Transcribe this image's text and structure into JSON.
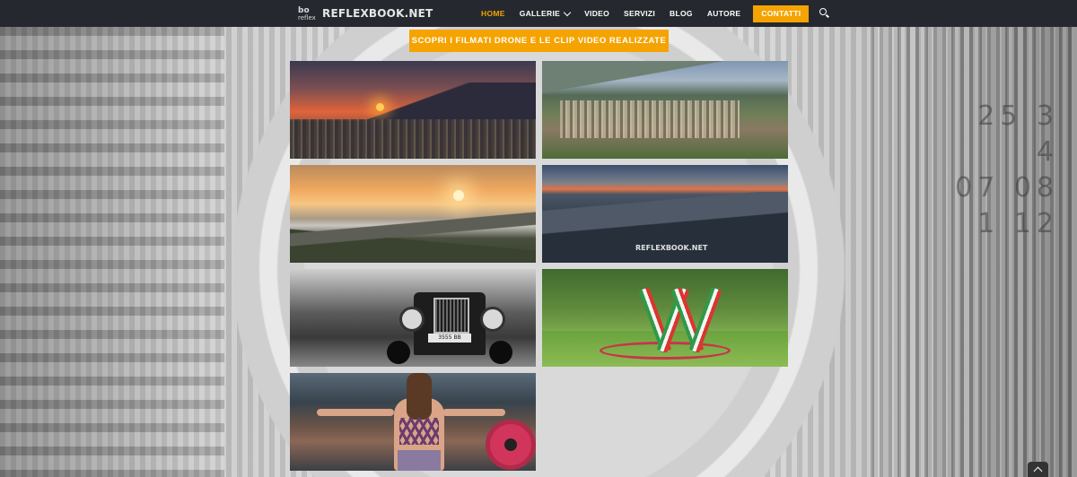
{
  "header": {
    "logo_mark_top": "bo",
    "logo_mark_bottom": "reflex",
    "logo_text": "REFLEXBOOK.NET",
    "nav": [
      {
        "label": "HOME",
        "active": true
      },
      {
        "label": "GALLERIE",
        "has_dropdown": true
      },
      {
        "label": "VIDEO"
      },
      {
        "label": "SERVIZI"
      },
      {
        "label": "BLOG"
      },
      {
        "label": "AUTORE"
      }
    ],
    "contact_label": "CONTATTI",
    "search_icon": "search-icon"
  },
  "cta": {
    "label": "SCOPRI I FILMATI DRONE E LE CLIP VIDEO REALIZZATE"
  },
  "gallery": {
    "watermark": "REFLEXBOOK.NET",
    "car_plate": "3555 BB",
    "tiles": [
      {
        "subject": "sunset-town"
      },
      {
        "subject": "aerial-valley-town"
      },
      {
        "subject": "sunrise-fog-valley"
      },
      {
        "subject": "dusk-aerial-valley"
      },
      {
        "subject": "vintage-car-bw"
      },
      {
        "subject": "park-w-sign"
      },
      {
        "subject": "gym-woman"
      }
    ]
  },
  "background": {
    "lens_numbers": [
      "25 3",
      "4",
      "07 08",
      "1 12"
    ]
  },
  "colors": {
    "accent": "#f5a300",
    "header_bg": "#25292f",
    "nav_text": "#ffffff"
  },
  "scroll_top_icon": "chevron-up-icon"
}
